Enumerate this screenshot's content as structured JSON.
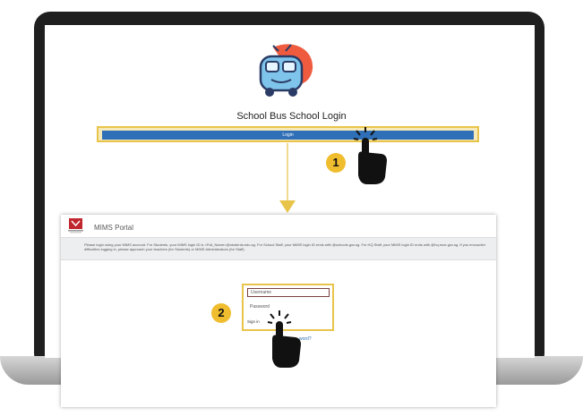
{
  "top_page": {
    "title": "School Bus School Login",
    "login_button": "Login",
    "step_1": "1"
  },
  "portal": {
    "title": "MIMS Portal",
    "crest_caption": "Ministry of Education SINGAPORE",
    "info": "Please login using your MIMS account. For Students, your MIMS login ID is <Full_Name>@students.edu.sg. For School Staff, your MIMS login ID ends with @schools.gov.sg. For HQ Staff, your MIMS login ID ends with @hq.moe.gov.sg. If you encounter difficulties logging in, please approach your teachers (for Students) or MIMS Administrators (for Staff).",
    "username_placeholder": "Username",
    "password_placeholder": "Password",
    "sign_in": "Sign in",
    "forgot_fragment": "word?",
    "step_2": "2"
  },
  "colors": {
    "accent_yellow": "#e9c44a",
    "login_blue": "#2f6fb7",
    "badge_yellow": "#f0bd2f"
  },
  "icons": [
    "bus-logo-icon",
    "pointing-hand-icon",
    "crest-icon",
    "down-arrow-icon"
  ]
}
